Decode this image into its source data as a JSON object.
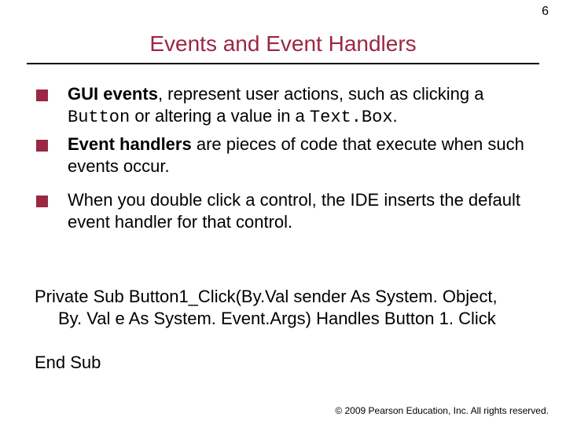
{
  "page_number": "6",
  "title": "Events and Event Handlers",
  "bullets": [
    {
      "parts": [
        {
          "text": "GUI events",
          "style": "bold"
        },
        {
          "text": ", represent user actions, such as clicking a "
        },
        {
          "text": "Button",
          "style": "mono"
        },
        {
          "text": " or altering a value in a "
        },
        {
          "text": "Text.Box",
          "style": "mono"
        },
        {
          "text": "."
        }
      ]
    },
    {
      "parts": [
        {
          "text": "Event handlers",
          "style": "bold"
        },
        {
          "text": " are pieces of code that execute when such events occur."
        }
      ]
    },
    {
      "spaced": true,
      "parts": [
        {
          "text": "When you double click a control, the IDE inserts the default event handler for that control."
        }
      ]
    }
  ],
  "code": {
    "line1": "Private Sub Button1_Click(By.Val sender As System. Object,",
    "line2": "By. Val e As System. Event.Args) Handles Button 1. Click",
    "line3": "End Sub"
  },
  "footer": {
    "copyright_symbol": "©",
    "text": " 2009 Pearson Education, Inc.  All rights reserved."
  }
}
